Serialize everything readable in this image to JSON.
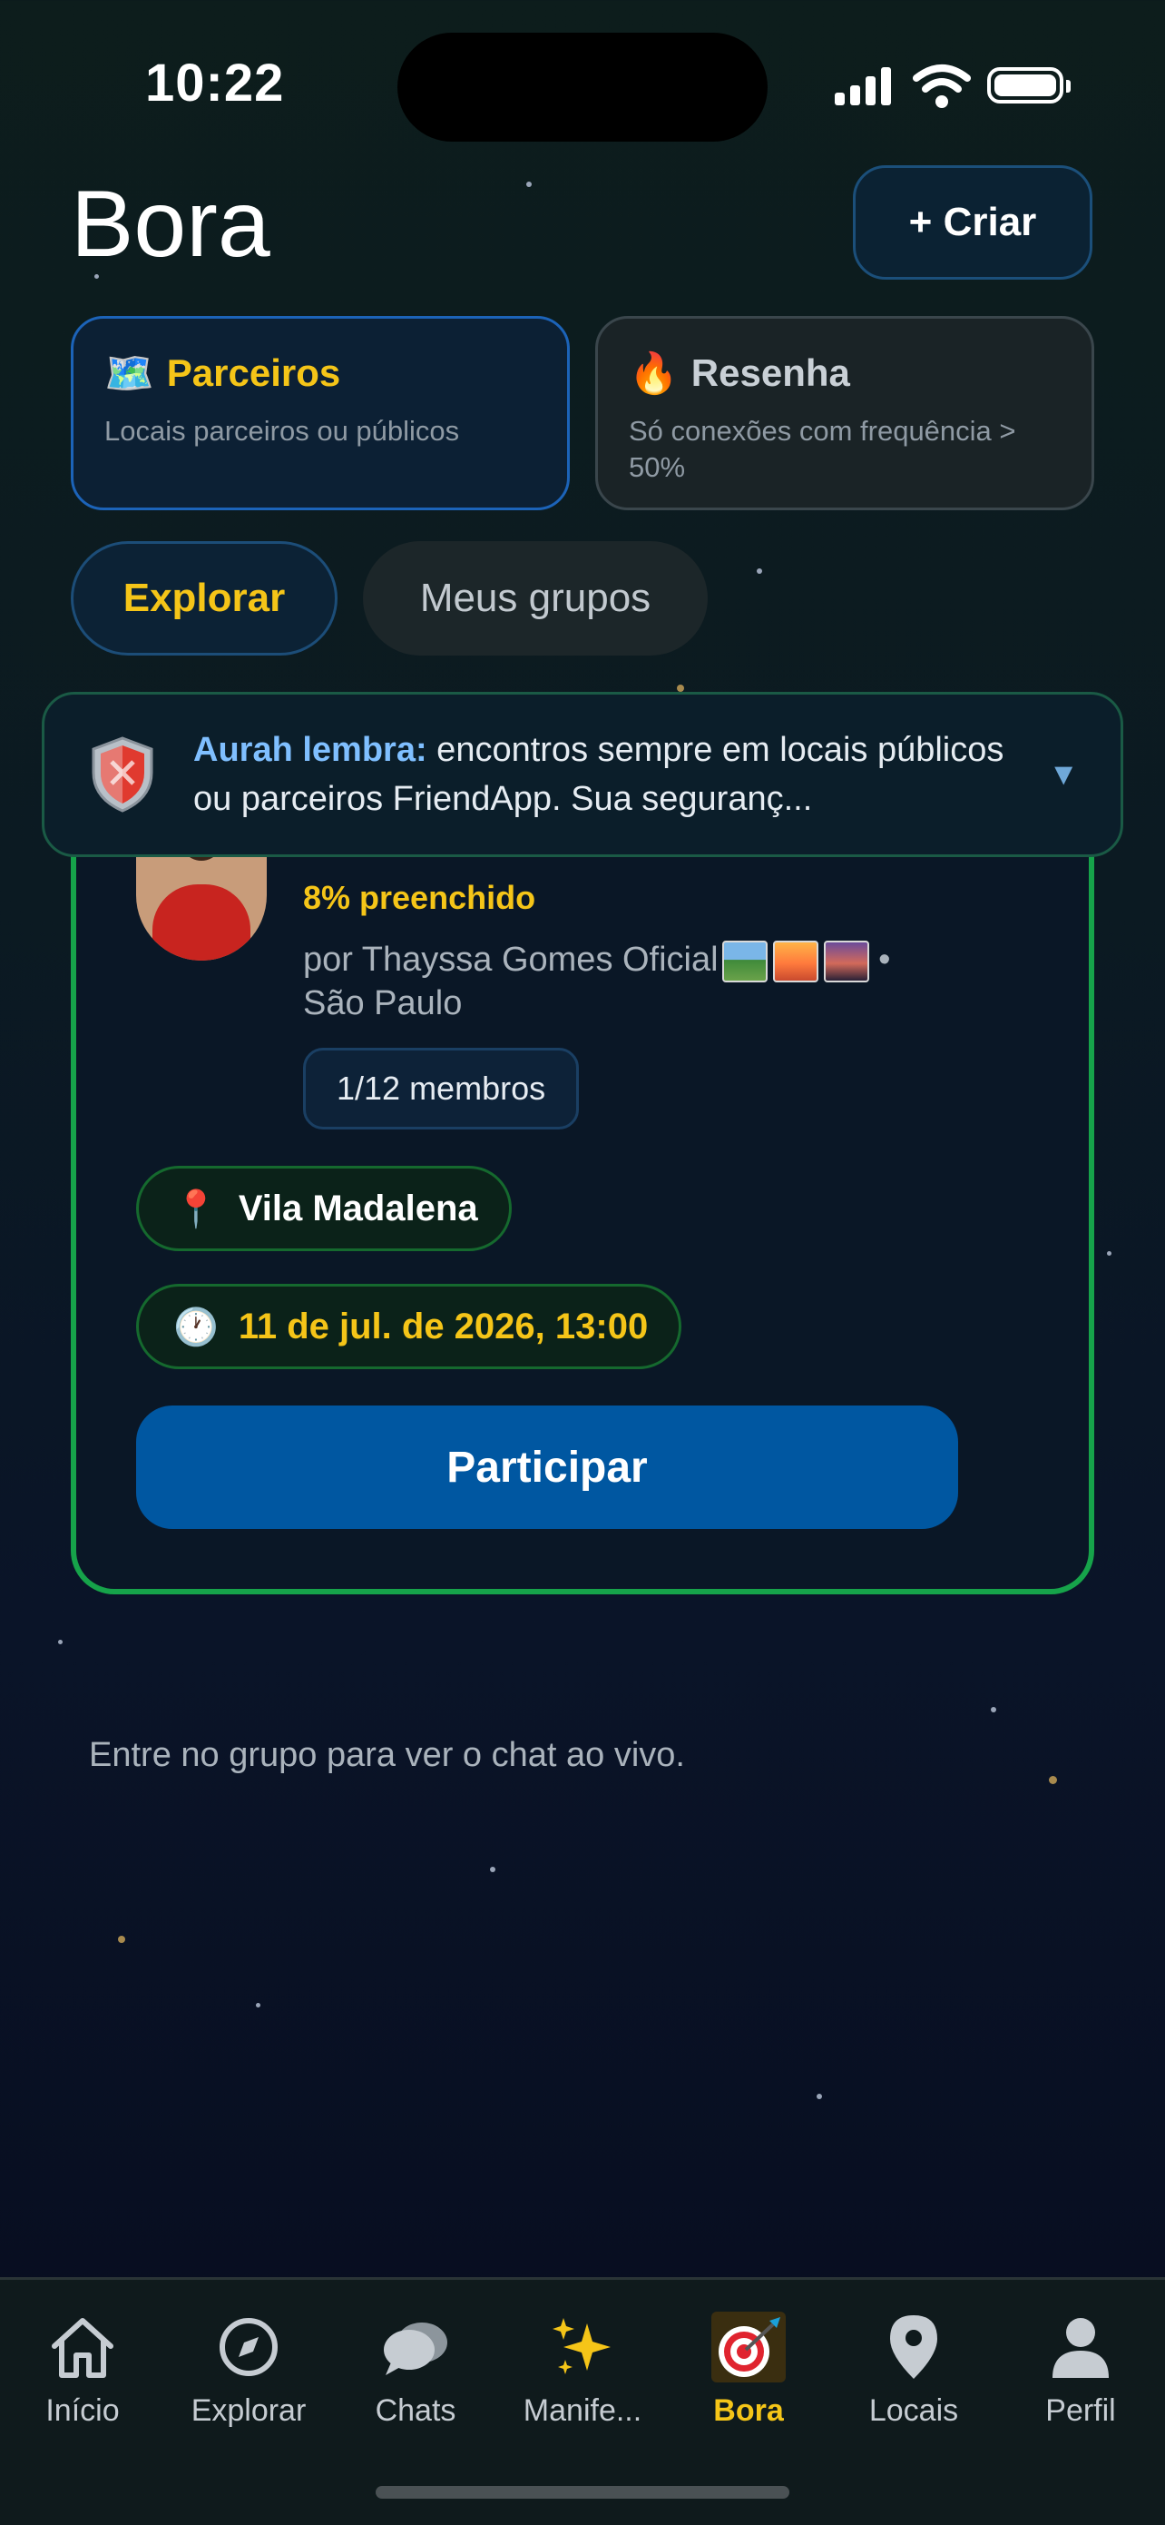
{
  "status_bar": {
    "time": "10:22"
  },
  "header": {
    "title": "Bora",
    "create_label": "+ Criar"
  },
  "filters": [
    {
      "emoji": "🗺️",
      "title": "Parceiros",
      "subtitle": "Locais parceiros ou públicos",
      "active": true
    },
    {
      "emoji": "🔥",
      "title": "Resenha",
      "subtitle": "Só conexões com frequência > 50%",
      "active": false
    }
  ],
  "segments": [
    {
      "label": "Explorar",
      "active": true
    },
    {
      "label": "Meus grupos",
      "active": false
    }
  ],
  "safety_banner": {
    "icon": "shield-icon",
    "lead": "Aurah lembra:",
    "text": " encontros sempre em locais públicos ou parceiros FriendApp. Sua seguranç..."
  },
  "group": {
    "fill_label": "8% preenchido",
    "author": "por Thayssa Gomes Oficial",
    "author_sep": "•",
    "city": "São Paulo",
    "members": "1/12 membros",
    "place_icon": "📍",
    "place": "Vila Madalena",
    "date_icon": "🕐",
    "date": "11 de jul. de 2026, 13:00",
    "join_label": "Participar"
  },
  "chat_note": "Entre no grupo para ver o chat ao vivo.",
  "tabs": [
    {
      "label": "Início",
      "icon": "home-icon"
    },
    {
      "label": "Explorar",
      "icon": "compass-icon"
    },
    {
      "label": "Chats",
      "icon": "chat-bubbles-icon"
    },
    {
      "label": "Manife...",
      "icon": "sparkles-icon"
    },
    {
      "label": "Bora",
      "icon": "dart-target-icon",
      "active": true
    },
    {
      "label": "Locais",
      "icon": "map-pin-icon"
    },
    {
      "label": "Perfil",
      "icon": "person-icon"
    }
  ],
  "colors": {
    "accent": "#f5c518",
    "primary_button": "#0057a1",
    "card_border": "#16a34a"
  }
}
